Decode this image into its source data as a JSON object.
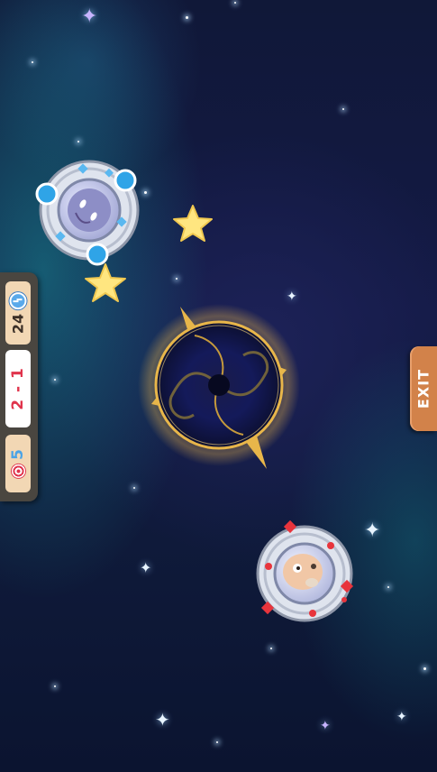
{
  "hud": {
    "time_value": "24",
    "score_value": "2 - 1",
    "target_value": "5",
    "time_icon": "clock-icon",
    "target_icon": "target-icon"
  },
  "exit": {
    "label": "EXIT"
  },
  "colors": {
    "hud_bg": "#4a4640",
    "hud_cell": "#f2d7b4",
    "score_text": "#e0344c",
    "target_text": "#4aa3e6",
    "exit_bg": "#d2824a",
    "portal_gold": "#e8b64a",
    "star_yellow": "#ffe680"
  },
  "icons": {
    "player_pod_top": "blue-ufo-pod-icon",
    "opponent_pod_bottom": "red-ufo-pod-icon",
    "portal": "black-hole-portal-icon",
    "collectible": "star-icon"
  }
}
